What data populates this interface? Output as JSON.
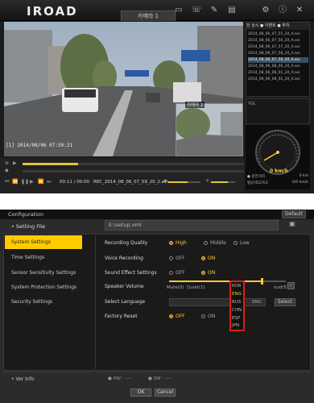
{
  "player": {
    "logo": "IROAD",
    "camera_tab": "카메라 1",
    "toolbar_icons": [
      "monitor-icon",
      "phone-icon",
      "settings-tool-icon",
      "folder-icon",
      "gear-icon",
      "info-icon",
      "close-icon"
    ],
    "timestamp": "[1] 2014/08/06 07:59:21",
    "pip_label": "카메라 2",
    "file_list": {
      "header": "전 상시  ● 이벤트  ● 주차",
      "items": [
        "2014_08_06_07_55_20_A.avi",
        "2014_08_06_07_56_20_A.avi",
        "2014_08_06_07_57_20_A.avi",
        "2014_08_06_07_58_20_A.avi",
        "2014_08_06_07_59_20_A.avi",
        "2014_08_06_08_00_20_A.avi",
        "2014_08_06_08_01_20_A.avi",
        "2014_08_06_08_02_20_A.avi"
      ],
      "selected_index": 4
    },
    "map_tab": "지도",
    "speed": {
      "value": "0 km/h",
      "ticks": [
        "0",
        "20",
        "40",
        "60",
        "80",
        "100",
        "120",
        "140",
        "160",
        "180",
        "200"
      ],
      "row1_left": "● 운전거리",
      "row1_right": "0 km",
      "row2_left": "평균/최고속도",
      "row2_right": "0/0 km/h"
    },
    "track_progress": 0.25,
    "play_position": "00:11 / 00:00",
    "filename": "REC_2014_08_06_07_59_20_2.avi",
    "volume1": 0.6,
    "volume2": 0.7
  },
  "config": {
    "title": "Configuration",
    "default_label": "Default",
    "setting_file_label": "• Setting File",
    "setting_file_path": "E:\\setup.xml",
    "sidebar": [
      {
        "label": "System Settings",
        "active": true
      },
      {
        "label": "Time Settings",
        "active": false
      },
      {
        "label": "Sensor Sensitivity Settings",
        "active": false
      },
      {
        "label": "System Protection Settings",
        "active": false
      },
      {
        "label": "Security Settings",
        "active": false
      }
    ],
    "recording_quality": {
      "label": "Recording Quality",
      "options": [
        "High",
        "Middle",
        "Low"
      ],
      "selected": 0
    },
    "voice_recording": {
      "label": "Voice Recording",
      "options": [
        "OFF",
        "ON"
      ],
      "selected": 1
    },
    "sound_effect": {
      "label": "Sound Effect Settings",
      "options": [
        "OFF",
        "ON"
      ],
      "selected": 1
    },
    "speaker_volume": {
      "label": "Speaker Volume",
      "min_label": "Mute(0)",
      "quiet_label": "Quiet(1)",
      "max_label": "oud(5)",
      "value_fraction": 0.8
    },
    "select_language": {
      "label": "Select Language",
      "value": "ENG",
      "button": "Select"
    },
    "factory_reset": {
      "label": "Factory Reset",
      "options": [
        "OFF",
        "ON"
      ],
      "selected": 0
    },
    "language_dropdown": {
      "options": [
        "KOR",
        "ENG",
        "RUS",
        "CHN",
        "ESP",
        "JPN"
      ],
      "selected": 1
    },
    "ver_info": "• Ver Info",
    "hw": "● HW : ----",
    "sw": "● SW : ----",
    "ok": "OK",
    "cancel": "Cancel"
  },
  "colors": {
    "accent": "#ffcc00",
    "highlight": "#e21a1a"
  }
}
